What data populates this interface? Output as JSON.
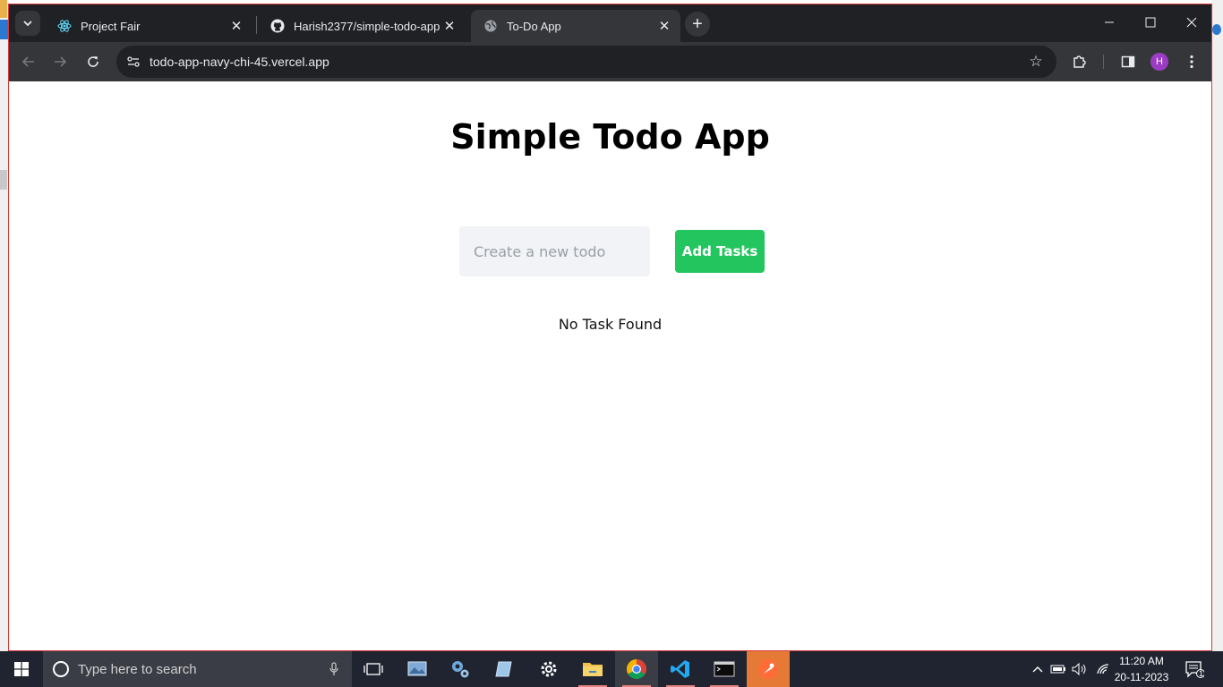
{
  "browser": {
    "tabs": [
      {
        "label": "Project Fair",
        "icon": "react-icon",
        "active": false
      },
      {
        "label": "Harish2377/simple-todo-app",
        "icon": "github-icon",
        "active": false
      },
      {
        "label": "To-Do App",
        "icon": "globe-icon",
        "active": true
      }
    ],
    "url": "todo-app-navy-chi-45.vercel.app",
    "profile_initial": "H",
    "profile_color": "#9c3cc4"
  },
  "app": {
    "title": "Simple Todo App",
    "input_placeholder": "Create a new todo",
    "input_value": "",
    "add_button_label": "Add Tasks",
    "add_button_color": "#22c55e",
    "empty_message": "No Task Found"
  },
  "taskbar": {
    "search_placeholder": "Type here to search",
    "time": "11:20 AM",
    "date": "20-11-2023",
    "notification_count": "1",
    "apps": [
      "task-view-icon",
      "photos-icon",
      "settings-icon",
      "notepad-icon",
      "gear-icon",
      "file-explorer-icon",
      "chrome-icon",
      "vscode-icon",
      "terminal-icon",
      "postman-icon"
    ]
  }
}
